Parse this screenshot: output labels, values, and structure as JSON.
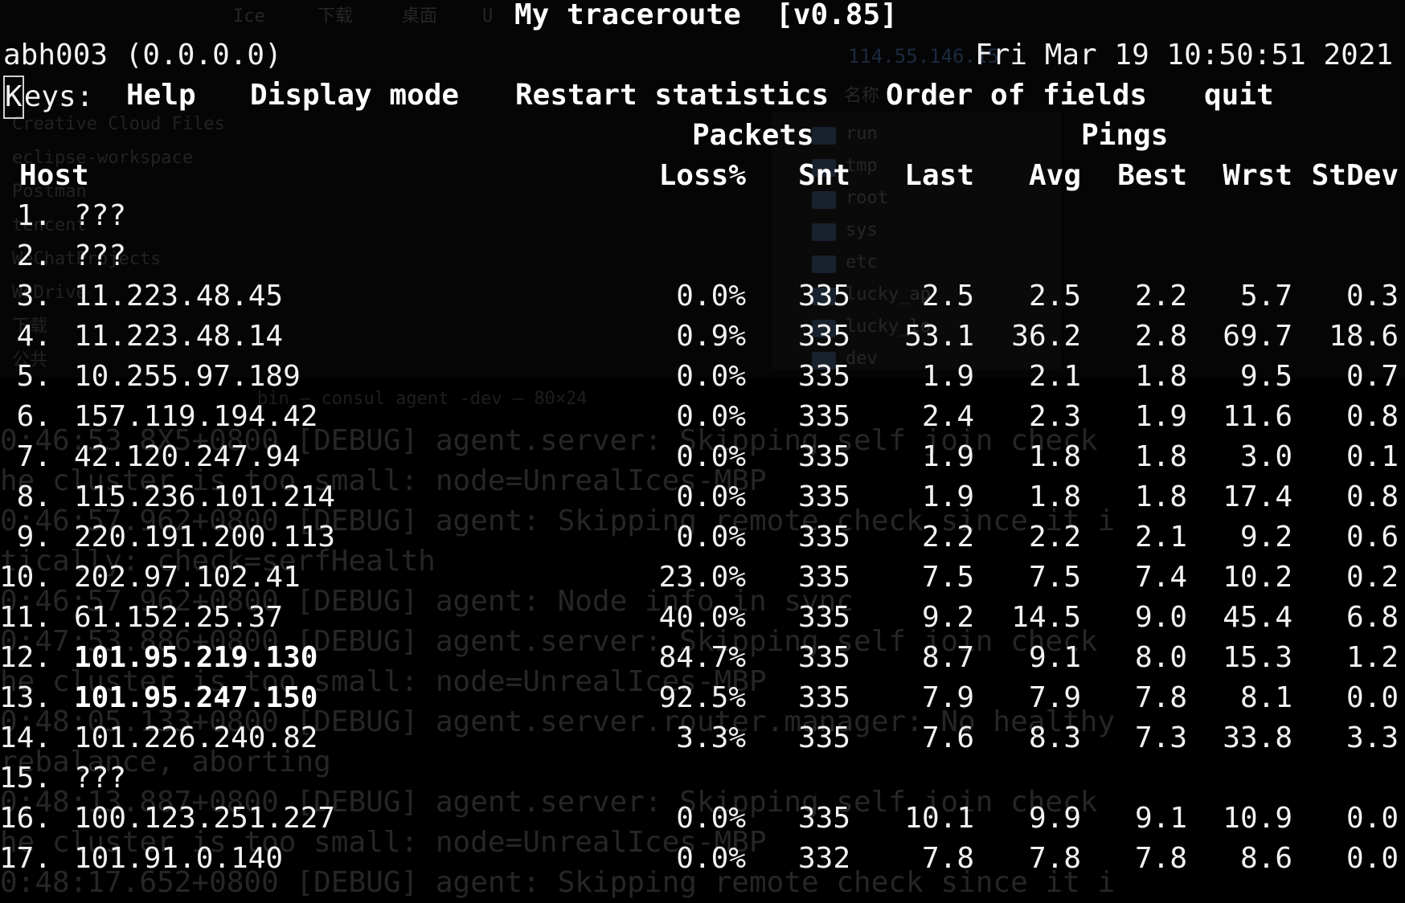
{
  "title": "My traceroute  [v0.85]",
  "hostname": "abh003 (0.0.0.0)",
  "datetime": "Fri Mar 19 10:50:51 2021",
  "keys": {
    "label": "Keys:",
    "help": "Help",
    "display_mode": "Display mode",
    "restart": "Restart statistics",
    "order": "Order of fields",
    "quit": "quit"
  },
  "group_headers": {
    "packets": "Packets",
    "pings": "Pings"
  },
  "columns": [
    "Host",
    "Loss%",
    "Snt",
    "Last",
    "Avg",
    "Best",
    "Wrst",
    "StDev"
  ],
  "hops": [
    {
      "n": "1.",
      "host": "???",
      "bold": false,
      "loss": "",
      "snt": "",
      "last": "",
      "avg": "",
      "best": "",
      "wrst": "",
      "stdev": ""
    },
    {
      "n": "2.",
      "host": "???",
      "bold": false,
      "loss": "",
      "snt": "",
      "last": "",
      "avg": "",
      "best": "",
      "wrst": "",
      "stdev": ""
    },
    {
      "n": "3.",
      "host": "11.223.48.45",
      "bold": false,
      "loss": "0.0%",
      "snt": "335",
      "last": "2.5",
      "avg": "2.5",
      "best": "2.2",
      "wrst": "5.7",
      "stdev": "0.3"
    },
    {
      "n": "4.",
      "host": "11.223.48.14",
      "bold": false,
      "loss": "0.9%",
      "snt": "335",
      "last": "53.1",
      "avg": "36.2",
      "best": "2.8",
      "wrst": "69.7",
      "stdev": "18.6"
    },
    {
      "n": "5.",
      "host": "10.255.97.189",
      "bold": false,
      "loss": "0.0%",
      "snt": "335",
      "last": "1.9",
      "avg": "2.1",
      "best": "1.8",
      "wrst": "9.5",
      "stdev": "0.7"
    },
    {
      "n": "6.",
      "host": "157.119.194.42",
      "bold": false,
      "loss": "0.0%",
      "snt": "335",
      "last": "2.4",
      "avg": "2.3",
      "best": "1.9",
      "wrst": "11.6",
      "stdev": "0.8"
    },
    {
      "n": "7.",
      "host": "42.120.247.94",
      "bold": false,
      "loss": "0.0%",
      "snt": "335",
      "last": "1.9",
      "avg": "1.8",
      "best": "1.8",
      "wrst": "3.0",
      "stdev": "0.1"
    },
    {
      "n": "8.",
      "host": "115.236.101.214",
      "bold": false,
      "loss": "0.0%",
      "snt": "335",
      "last": "1.9",
      "avg": "1.8",
      "best": "1.8",
      "wrst": "17.4",
      "stdev": "0.8"
    },
    {
      "n": "9.",
      "host": "220.191.200.113",
      "bold": false,
      "loss": "0.0%",
      "snt": "335",
      "last": "2.2",
      "avg": "2.2",
      "best": "2.1",
      "wrst": "9.2",
      "stdev": "0.6"
    },
    {
      "n": "10.",
      "host": "202.97.102.41",
      "bold": false,
      "loss": "23.0%",
      "snt": "335",
      "last": "7.5",
      "avg": "7.5",
      "best": "7.4",
      "wrst": "10.2",
      "stdev": "0.2"
    },
    {
      "n": "11.",
      "host": "61.152.25.37",
      "bold": false,
      "loss": "40.0%",
      "snt": "335",
      "last": "9.2",
      "avg": "14.5",
      "best": "9.0",
      "wrst": "45.4",
      "stdev": "6.8"
    },
    {
      "n": "12.",
      "host": "101.95.219.130",
      "bold": true,
      "loss": "84.7%",
      "snt": "335",
      "last": "8.7",
      "avg": "9.1",
      "best": "8.0",
      "wrst": "15.3",
      "stdev": "1.2"
    },
    {
      "n": "13.",
      "host": "101.95.247.150",
      "bold": true,
      "loss": "92.5%",
      "snt": "335",
      "last": "7.9",
      "avg": "7.9",
      "best": "7.8",
      "wrst": "8.1",
      "stdev": "0.0"
    },
    {
      "n": "14.",
      "host": "101.226.240.82",
      "bold": false,
      "loss": "3.3%",
      "snt": "335",
      "last": "7.6",
      "avg": "8.3",
      "best": "7.3",
      "wrst": "33.8",
      "stdev": "3.3"
    },
    {
      "n": "15.",
      "host": "???",
      "bold": false,
      "loss": "",
      "snt": "",
      "last": "",
      "avg": "",
      "best": "",
      "wrst": "",
      "stdev": ""
    },
    {
      "n": "16.",
      "host": "100.123.251.227",
      "bold": false,
      "loss": "0.0%",
      "snt": "335",
      "last": "10.1",
      "avg": "9.9",
      "best": "9.1",
      "wrst": "10.9",
      "stdev": "0.0"
    },
    {
      "n": "17.",
      "host": "101.91.0.140",
      "bold": false,
      "loss": "0.0%",
      "snt": "332",
      "last": "7.8",
      "avg": "7.8",
      "best": "7.8",
      "wrst": "8.6",
      "stdev": "0.0"
    }
  ],
  "background_ghost": {
    "finder_tabs": [
      "Ice",
      "下载",
      "桌面",
      "U"
    ],
    "finder_sidebar": [
      "Creative Cloud Files",
      "eclipse-workspace",
      "Postman",
      "tencent",
      "WeChatProjects",
      "WeDrive",
      "下载",
      "公共"
    ],
    "finder_folders": [
      "run",
      "tmp",
      "root",
      "sys",
      "etc",
      "lucky_ap",
      "lucky_lo",
      "dev"
    ],
    "finder_name_header": "名称",
    "ip_ghost": "114.55.146.15",
    "window_title": "bin — consul agent -dev — 80×24",
    "log_lines": [
      "0:46:53.8X5+0800 [DEBUG] agent.server: Skipping self join check",
      "he cluster is too small: node=UnrealIces-MBP",
      "0:46:57.962+0800 [DEBUG] agent: Skipping remote check since it i",
      "tically: check=serfHealth",
      "0:46:57.962+0800 [DEBUG] agent: Node info in sync",
      "0:47:53.886+0800 [DEBUG] agent.server: Skipping self join check",
      "he cluster is too small: node=UnrealIces-MBP",
      "0:48:05.133+0800 [DEBUG] agent.server.router.manager: No healthy",
      "rebalance, aborting",
      "0:48:13.887+0800 [DEBUG] agent.server: Skipping self join check",
      "he cluster is too small: node=UnrealIces-MBP",
      "0:48:17.652+0800 [DEBUG] agent: Skipping remote check since it i"
    ]
  },
  "colors": {
    "background": "#000000",
    "text": "#f2f2f2",
    "ghost": "#2a2a2a"
  }
}
